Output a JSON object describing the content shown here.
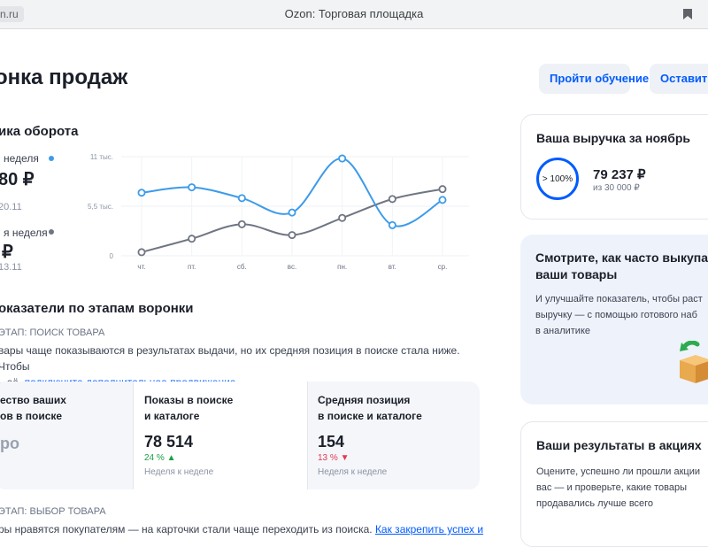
{
  "browser": {
    "url_fragment": "n.ru",
    "tab_title": "Ozon: Торговая площадка"
  },
  "header": {
    "title": "онка продаж",
    "buttons": {
      "training": "Пройти обучение",
      "feedback": "Оставить"
    }
  },
  "dynamics": {
    "title": "ика оборота",
    "current_week": {
      "label": "неделя",
      "value": "80 ₽",
      "date": "20.11",
      "color": "#3d9be9"
    },
    "previous_week": {
      "label": "я неделя",
      "value": "₽",
      "date": "13.11",
      "color": "#6f7583"
    }
  },
  "chart_data": {
    "type": "line",
    "categories": [
      "чт.",
      "пт.",
      "сб.",
      "вс.",
      "пн.",
      "вт.",
      "ср."
    ],
    "yticks": [
      "11 тыс.",
      "5,5 тыс.",
      "0"
    ],
    "ylim": [
      0,
      11000
    ],
    "series": [
      {
        "color": "#3d9be9",
        "values": [
          7000,
          7600,
          6400,
          4800,
          10800,
          3400,
          6200
        ]
      },
      {
        "color": "#6f7583",
        "values": [
          400,
          1900,
          3500,
          2300,
          4200,
          6300,
          7400
        ]
      }
    ]
  },
  "funnel": {
    "title": "оказатели по этапам воронки",
    "stage1": {
      "label": "ЭТАП: ПОИСК ТОВАРА",
      "text_line1": "вары чаще показываются в результатах выдачи, но их средняя позиция в поиске стала ниже. Чтобы",
      "text_line2_prefix": "ь её, ",
      "text_link": "подключите дополнительное продвижение"
    },
    "metrics": [
      {
        "title_line1": "ество ваших",
        "title_line2": "ов в поиске",
        "value": "ро",
        "delta": "",
        "sub": ""
      },
      {
        "title_line1": "Показы в поиске",
        "title_line2": "и каталоге",
        "value": "78 514",
        "delta": "24 %",
        "delta_arrow": "▲",
        "delta_color": "#1aa045",
        "sub": "Неделя к неделе"
      },
      {
        "title_line1": "Средняя позиция",
        "title_line2": "в поиске и каталоге",
        "value": "154",
        "delta": "13 %",
        "delta_arrow": "▼",
        "delta_color": "#e53950",
        "sub": "Неделя к неделе"
      }
    ],
    "stage2": {
      "label": "ЭТАП: ВЫБОР ТОВАРА",
      "text_prefix": "ры нравятся покупателям — на карточки стали чаще переходить из поиска. ",
      "text_link": "Как закрепить успех и"
    }
  },
  "panels": {
    "revenue": {
      "title": "Ваша выручка за ноябрь",
      "percent": "> 100%",
      "amount": "79 237 ₽",
      "target": "из 30 000 ₽"
    },
    "buyout": {
      "title_line1": "Смотрите, как часто выкупа",
      "title_line2": "ваши товары",
      "text_line1": "И улучшайте показатель, чтобы раст",
      "text_line2": "выручку — с помощью готового наб",
      "text_line3": "в аналитике"
    },
    "promo": {
      "title": "Ваши результаты в акциях",
      "text_line1": "Оцените, успешно ли прошли акции",
      "text_line2": "вас — и проверьте, какие товары",
      "text_line3": "продавались лучше всего"
    }
  }
}
